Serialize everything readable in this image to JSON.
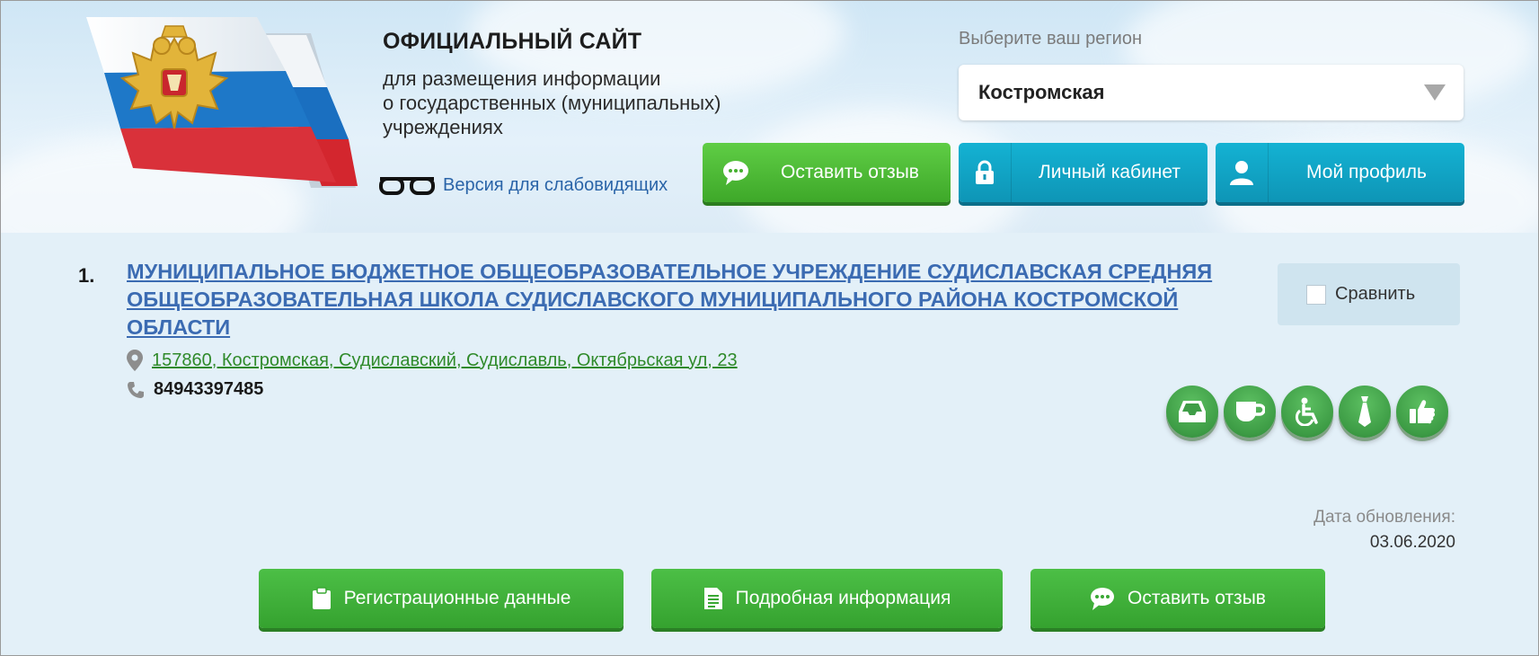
{
  "header": {
    "title": "ОФИЦИАЛЬНЫЙ САЙТ",
    "subtitle_lines": [
      "для размещения информации",
      "о государственных (муниципальных)",
      "учреждениях"
    ],
    "vision_label": "Версия для слабовидящих",
    "region_label": "Выберите ваш регион",
    "region_value": "Костромская",
    "buttons": {
      "feedback": "Оставить отзыв",
      "cabinet": "Личный кабинет",
      "profile": "Мой профиль"
    }
  },
  "result": {
    "number": "1.",
    "org_name": "МУНИЦИПАЛЬНОЕ БЮДЖЕТНОЕ ОБЩЕОБРАЗОВАТЕЛЬНОЕ УЧРЕЖДЕНИЕ СУДИСЛАВСКАЯ СРЕДНЯЯ ОБЩЕОБРАЗОВАТЕЛЬНАЯ ШКОЛА СУДИСЛАВСКОГО МУНИЦИПАЛЬНОГО РАЙОНА КОСТРОМСКОЙ ОБЛАСТИ",
    "address": "157860, Костромская, Судиславский, Судиславль, Октябрьская ул, 23",
    "phone": "84943397485",
    "compare_label": "Сравнить",
    "feature_icons": [
      "inbox-icon",
      "cup-icon",
      "wheelchair-icon",
      "tie-icon",
      "thumbs-up-icon"
    ],
    "updated_label": "Дата обновления:",
    "updated_date": "03.06.2020",
    "actions": {
      "registration": "Регистрационные данные",
      "details": "Подробная информация",
      "feedback": "Оставить отзыв"
    }
  },
  "colors": {
    "accent_green": "#3ea829",
    "accent_teal": "#0e95b6",
    "link_blue": "#3b6bb2",
    "address_green": "#2f8a2a",
    "background": "#e3f0f8"
  }
}
